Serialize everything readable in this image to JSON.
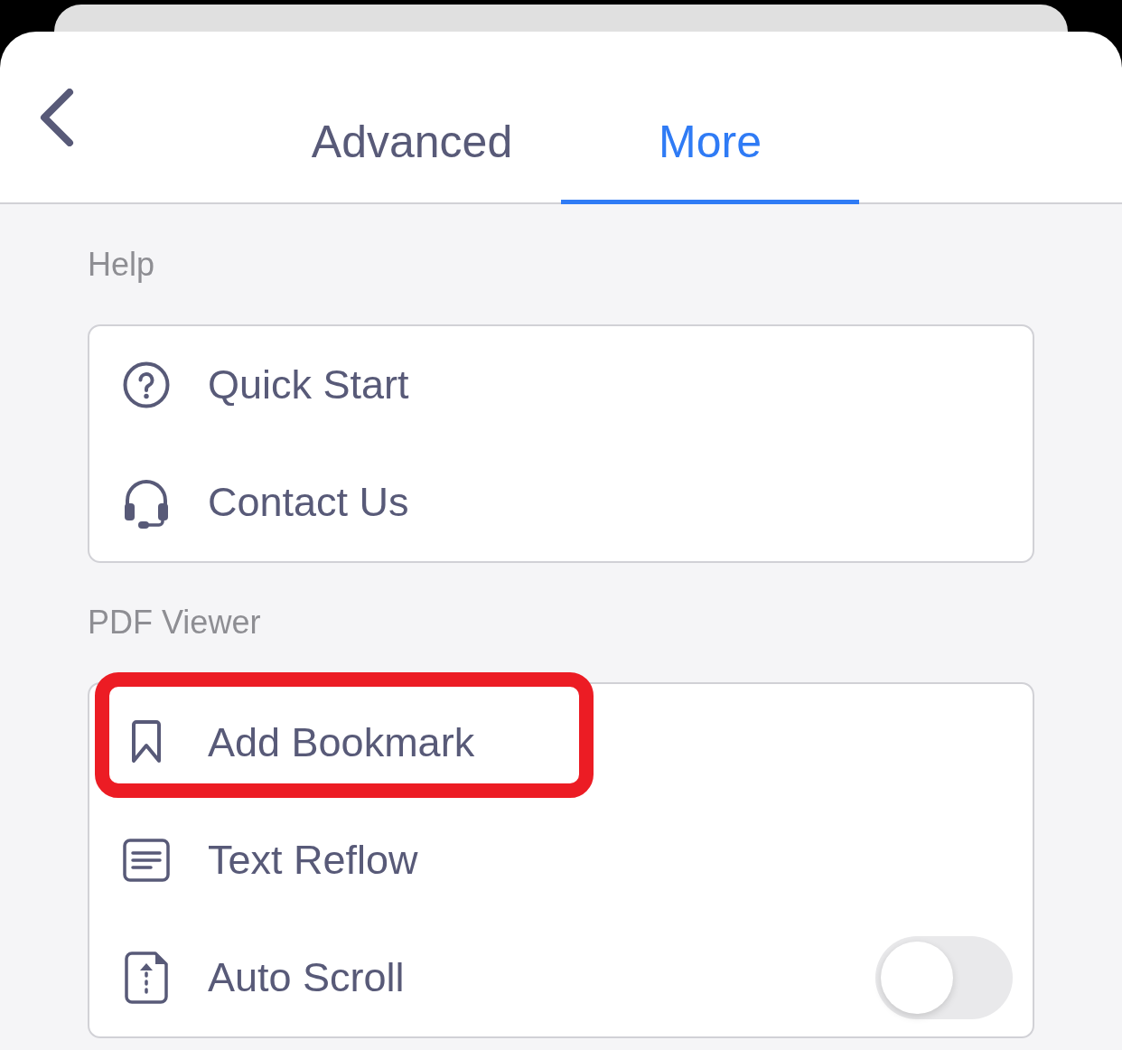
{
  "tabs": [
    {
      "label": "Advanced",
      "selected": false
    },
    {
      "label": "More",
      "selected": true
    }
  ],
  "sections": [
    {
      "title": "Help",
      "items": [
        {
          "kind": "link",
          "label": "Quick Start",
          "highlighted": false
        },
        {
          "kind": "link",
          "label": "Contact Us",
          "highlighted": false
        }
      ]
    },
    {
      "title": "PDF Viewer",
      "items": [
        {
          "kind": "link",
          "label": "Add Bookmark",
          "highlighted": true
        },
        {
          "kind": "link",
          "label": "Text Reflow",
          "highlighted": false
        },
        {
          "kind": "toggle",
          "label": "Auto Scroll",
          "on": false,
          "highlighted": false
        }
      ]
    }
  ]
}
